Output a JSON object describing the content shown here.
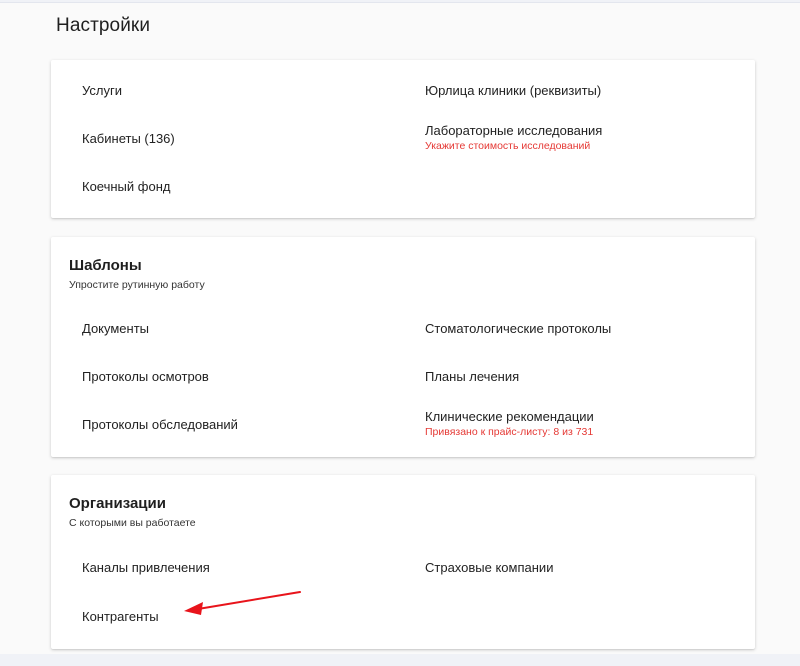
{
  "page": {
    "title": "Настройки"
  },
  "sections": {
    "general": {
      "items": {
        "services": {
          "label": "Услуги"
        },
        "legal_entity": {
          "label": "Юрлица клиники (реквизиты)"
        },
        "cabinets": {
          "label": "Кабинеты (136)"
        },
        "lab_research": {
          "label": "Лабораторные исследования",
          "hint": "Укажите стоимость исследований"
        },
        "bed_fund": {
          "label": "Коечный фонд"
        }
      }
    },
    "templates": {
      "title": "Шаблоны",
      "subtitle": "Упростите рутинную работу",
      "items": {
        "documents": {
          "label": "Документы"
        },
        "dental_protocols": {
          "label": "Стоматологические протоколы"
        },
        "exam_protocols": {
          "label": "Протоколы осмотров"
        },
        "treatment_plans": {
          "label": "Планы лечения"
        },
        "survey_protocols": {
          "label": "Протоколы обследований"
        },
        "clinical_guidelines": {
          "label": "Клинические рекомендации",
          "hint": "Привязано к прайс-листу: 8 из 731"
        }
      }
    },
    "organizations": {
      "title": "Организации",
      "subtitle": "С которыми вы работаете",
      "items": {
        "channels": {
          "label": "Каналы привлечения"
        },
        "insurers": {
          "label": "Страховые компании"
        },
        "counterparties": {
          "label": "Контрагенты"
        }
      }
    }
  },
  "colors": {
    "hint": "#e53935",
    "annotation_arrow": "#e8141b"
  },
  "annotation": {
    "icon": "red-arrow-icon"
  }
}
